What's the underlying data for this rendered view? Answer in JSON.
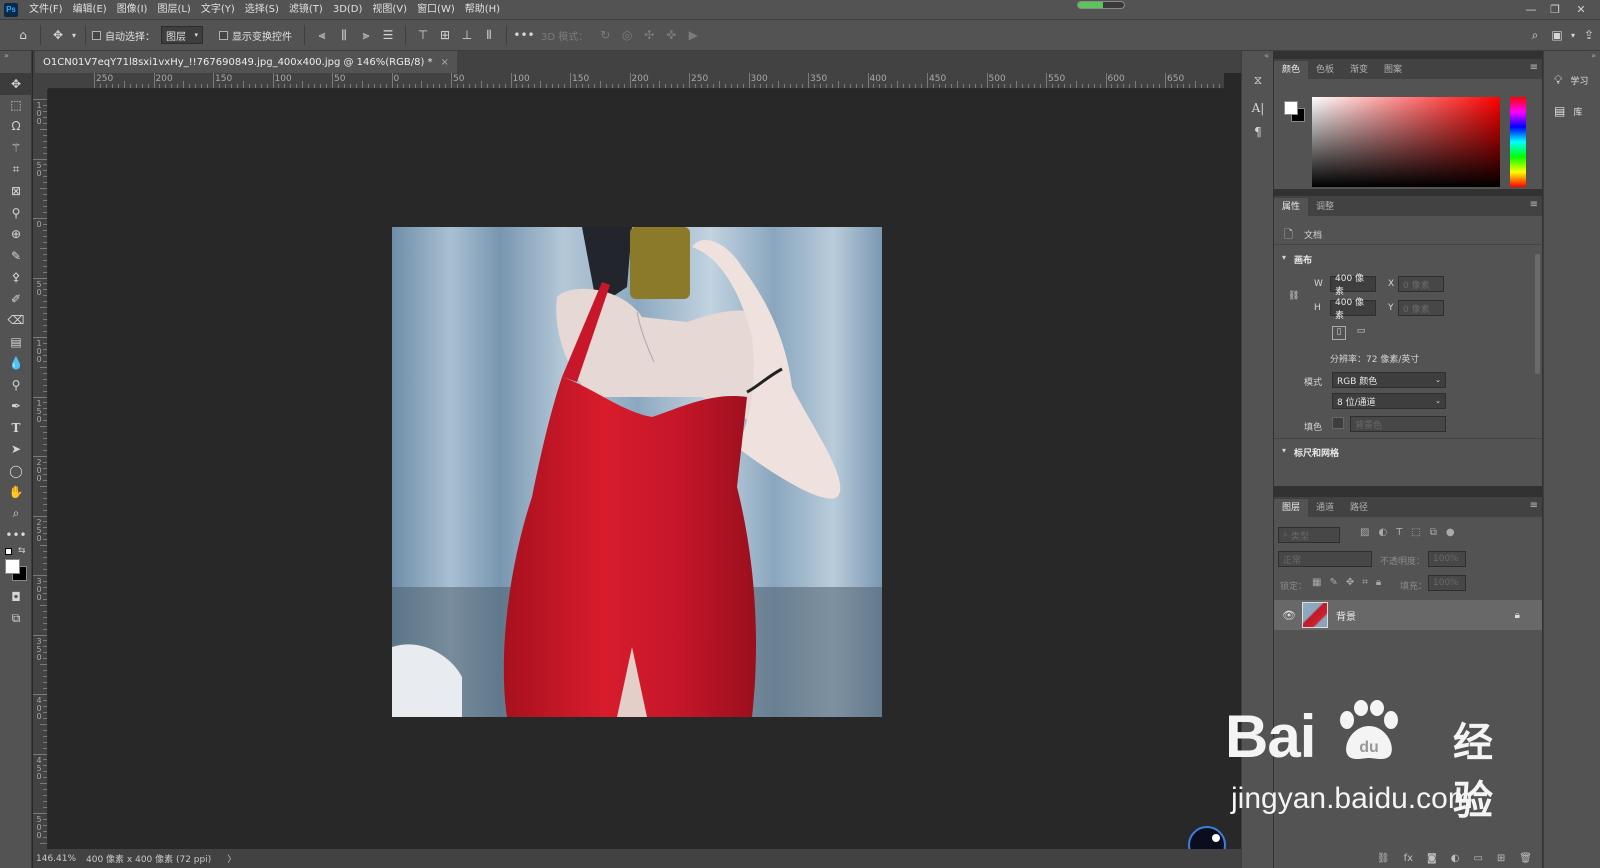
{
  "menubar": {
    "logo": "Ps",
    "items": [
      "文件(F)",
      "编辑(E)",
      "图像(I)",
      "图层(L)",
      "文字(Y)",
      "选择(S)",
      "滤镜(T)",
      "3D(D)",
      "视图(V)",
      "窗口(W)",
      "帮助(H)"
    ],
    "progress_fraction": 0.55
  },
  "options": {
    "auto_select_label": "自动选择：",
    "auto_select_value": "图层",
    "show_transform_label": "显示变换控件",
    "mode_3d_label": "3D 模式："
  },
  "doc_tab": {
    "title": "O1CN01V7eqY71l8sxi1vxHy_!!767690849.jpg_400x400.jpg @ 146%(RGB/8) *",
    "close": "×"
  },
  "ruler": {
    "top_labels": [
      "250",
      "200",
      "150",
      "100",
      "50",
      "0",
      "50",
      "100",
      "150",
      "200",
      "250",
      "300",
      "350",
      "400",
      "450",
      "500",
      "550",
      "600",
      "650"
    ],
    "left_labels": [
      "100",
      "50",
      "0",
      "50",
      "100",
      "150",
      "200",
      "250",
      "300",
      "350",
      "400",
      "450",
      "500"
    ]
  },
  "status": {
    "zoom": "146.41%",
    "doc_info": "400 像素 x 400 像素 (72 ppi)",
    "arrow": "〉"
  },
  "color_panel": {
    "tabs": [
      "颜色",
      "色板",
      "渐变",
      "图案"
    ]
  },
  "properties_panel": {
    "tabs": [
      "属性",
      "调整"
    ],
    "doc_label": "文档",
    "canvas_section": "画布",
    "w_label": "W",
    "w_value": "400 像素",
    "h_label": "H",
    "h_value": "400 像素",
    "x_label": "X",
    "x_value": "0 像素",
    "y_label": "Y",
    "y_value": "0 像素",
    "resolution": "分辨率：72 像素/英寸",
    "mode_label": "模式",
    "mode_value": "RGB 颜色",
    "bits_value": "8 位/通道",
    "fill_label": "填色",
    "fill_value": "背景色",
    "rulers_section": "标尺和网格"
  },
  "layers_panel": {
    "tabs": [
      "图层",
      "通道",
      "路径"
    ],
    "search_placeholder": "类型",
    "blend_mode": "正常",
    "opacity_label": "不透明度：",
    "opacity_value": "100%",
    "lock_label": "锁定：",
    "fill_label": "填充：",
    "fill_value": "100%",
    "layers": [
      {
        "name": "背景",
        "locked": true,
        "visible": true
      }
    ]
  },
  "learn_column": {
    "learn_label": "学习",
    "library_label": "库"
  },
  "watermark": {
    "brand": "Bai",
    "product": "经验",
    "url": "jingyan.baidu.com"
  }
}
